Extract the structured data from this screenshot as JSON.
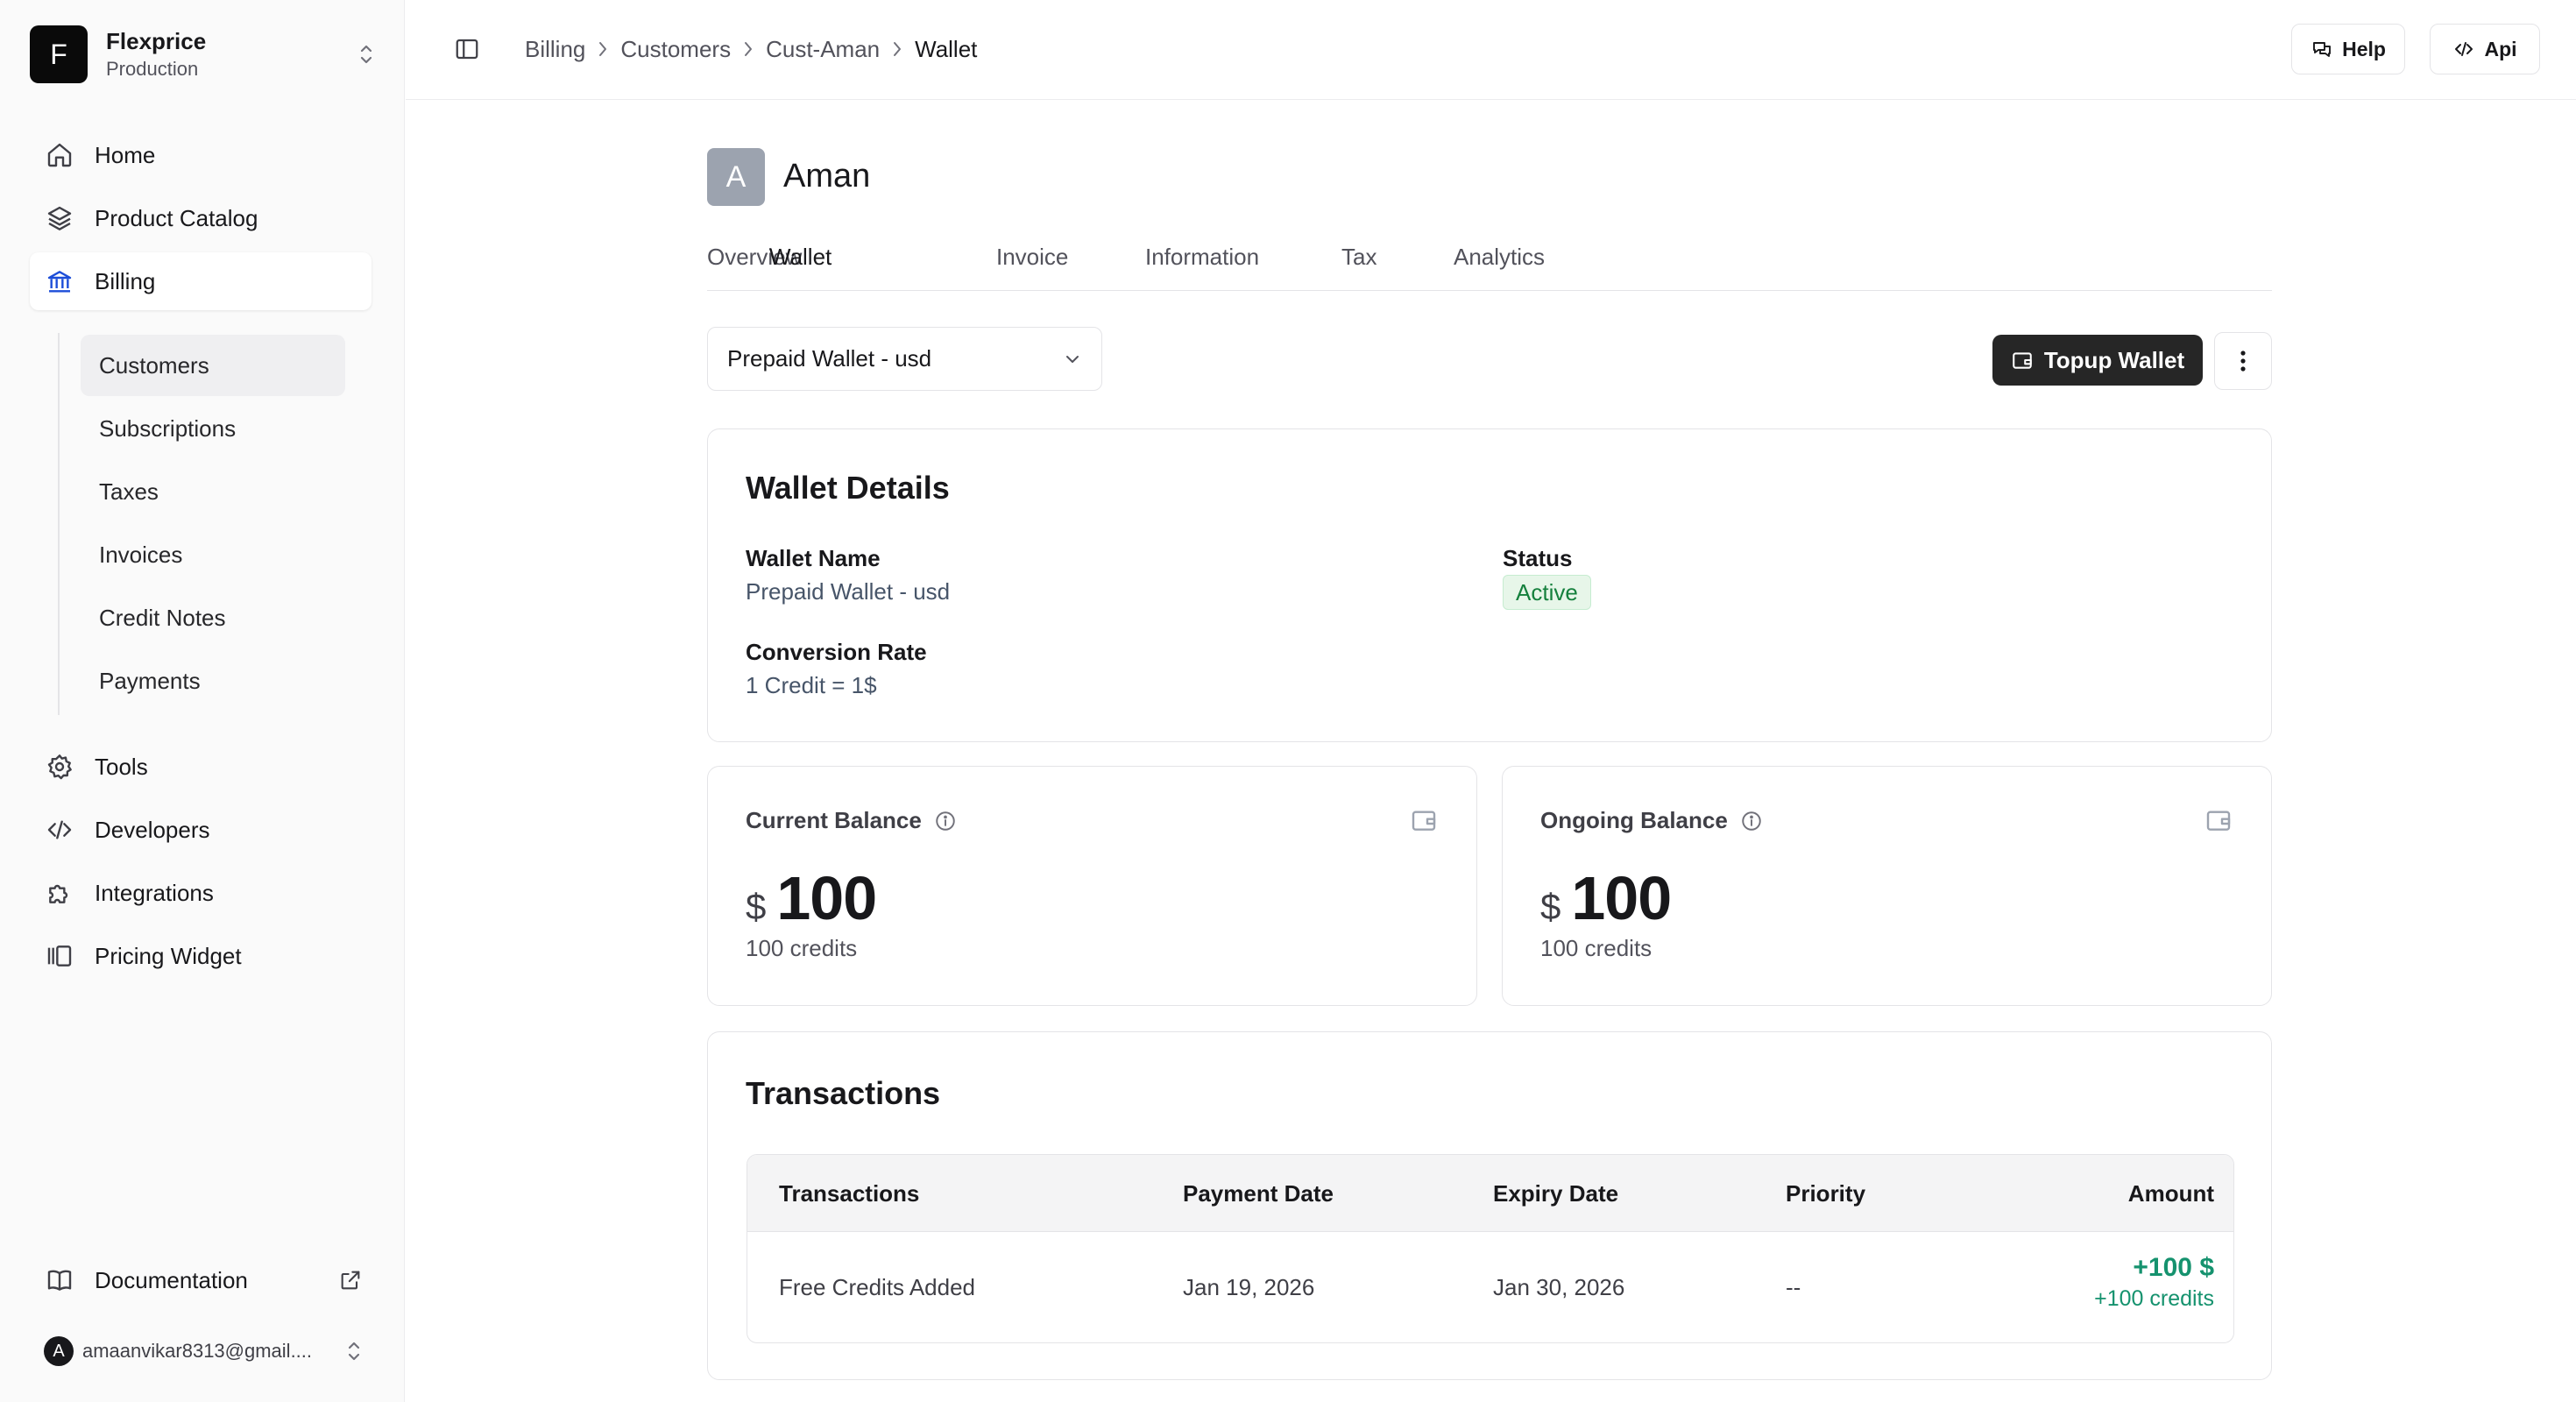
{
  "org": {
    "initial": "F",
    "name": "Flexprice",
    "environment": "Production"
  },
  "nav": {
    "main": [
      {
        "label": "Home",
        "icon": "home-icon"
      },
      {
        "label": "Product Catalog",
        "icon": "layers-icon"
      },
      {
        "label": "Billing",
        "icon": "bank-icon",
        "active": true
      }
    ],
    "billing_sub": [
      {
        "label": "Customers",
        "active": true
      },
      {
        "label": "Subscriptions"
      },
      {
        "label": "Taxes"
      },
      {
        "label": "Invoices"
      },
      {
        "label": "Credit Notes"
      },
      {
        "label": "Payments"
      }
    ],
    "lower": [
      {
        "label": "Tools",
        "icon": "gear-icon"
      },
      {
        "label": "Developers",
        "icon": "code-icon"
      },
      {
        "label": "Integrations",
        "icon": "puzzle-icon"
      },
      {
        "label": "Pricing Widget",
        "icon": "widget-icon"
      }
    ],
    "documentation": "Documentation"
  },
  "user": {
    "initial": "A",
    "email": "amaanvikar8313@gmail...."
  },
  "breadcrumb": [
    "Billing",
    "Customers",
    "Cust-Aman",
    "Wallet"
  ],
  "top_actions": {
    "help": "Help",
    "api": "Api"
  },
  "customer": {
    "initial": "A",
    "name": "Aman"
  },
  "tabs": [
    "Overview",
    "Wallet",
    "Invoice",
    "Information",
    "Tax",
    "Analytics"
  ],
  "active_tab": "Wallet",
  "wallet_select": {
    "value": "Prepaid Wallet - usd"
  },
  "topup_label": "Topup Wallet",
  "wallet_details": {
    "title": "Wallet Details",
    "name_label": "Wallet Name",
    "name_value": "Prepaid Wallet - usd",
    "status_label": "Status",
    "status_value": "Active",
    "rate_label": "Conversion Rate",
    "rate_value": "1 Credit = 1$"
  },
  "balances": {
    "current": {
      "label": "Current Balance",
      "currency": "$",
      "amount": "100",
      "credits": "100 credits"
    },
    "ongoing": {
      "label": "Ongoing Balance",
      "currency": "$",
      "amount": "100",
      "credits": "100 credits"
    }
  },
  "transactions": {
    "title": "Transactions",
    "columns": [
      "Transactions",
      "Payment Date",
      "Expiry Date",
      "Priority",
      "Amount"
    ],
    "rows": [
      {
        "description": "Free Credits Added",
        "payment_date": "Jan 19, 2026",
        "expiry_date": "Jan 30, 2026",
        "priority": "--",
        "amount": "+100 $",
        "credits": "+100 credits"
      }
    ]
  },
  "colors": {
    "accent_dark": "#262626",
    "success": "#15926e",
    "active_badge_bg": "#e7f6e9"
  }
}
